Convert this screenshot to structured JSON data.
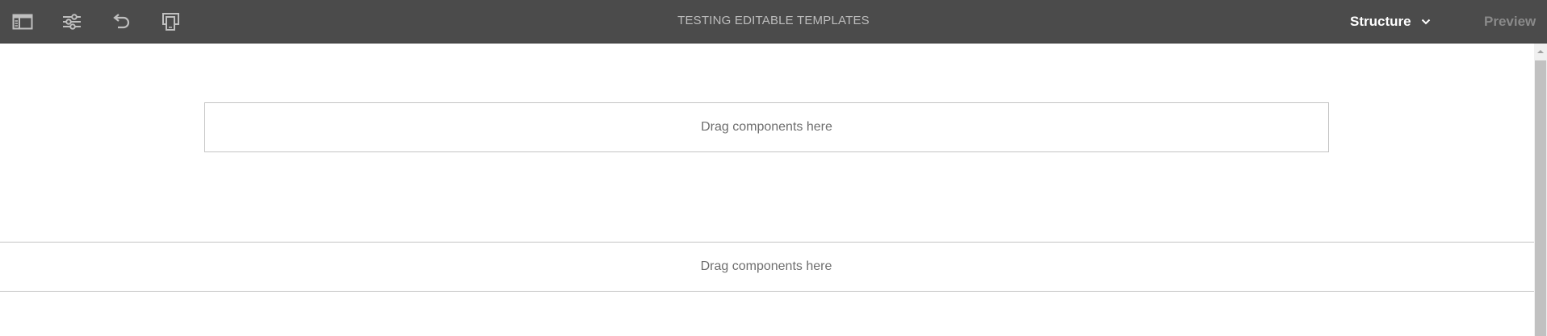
{
  "toolbar": {
    "icons": [
      "side-panel-icon",
      "page-properties-icon",
      "undo-icon",
      "emulator-icon"
    ],
    "title": "TESTING EDITABLE TEMPLATES",
    "mode_label": "Structure",
    "preview_label": "Preview"
  },
  "canvas": {
    "dropzones": [
      {
        "label": "Drag components here"
      },
      {
        "label": "Drag components here"
      }
    ]
  }
}
